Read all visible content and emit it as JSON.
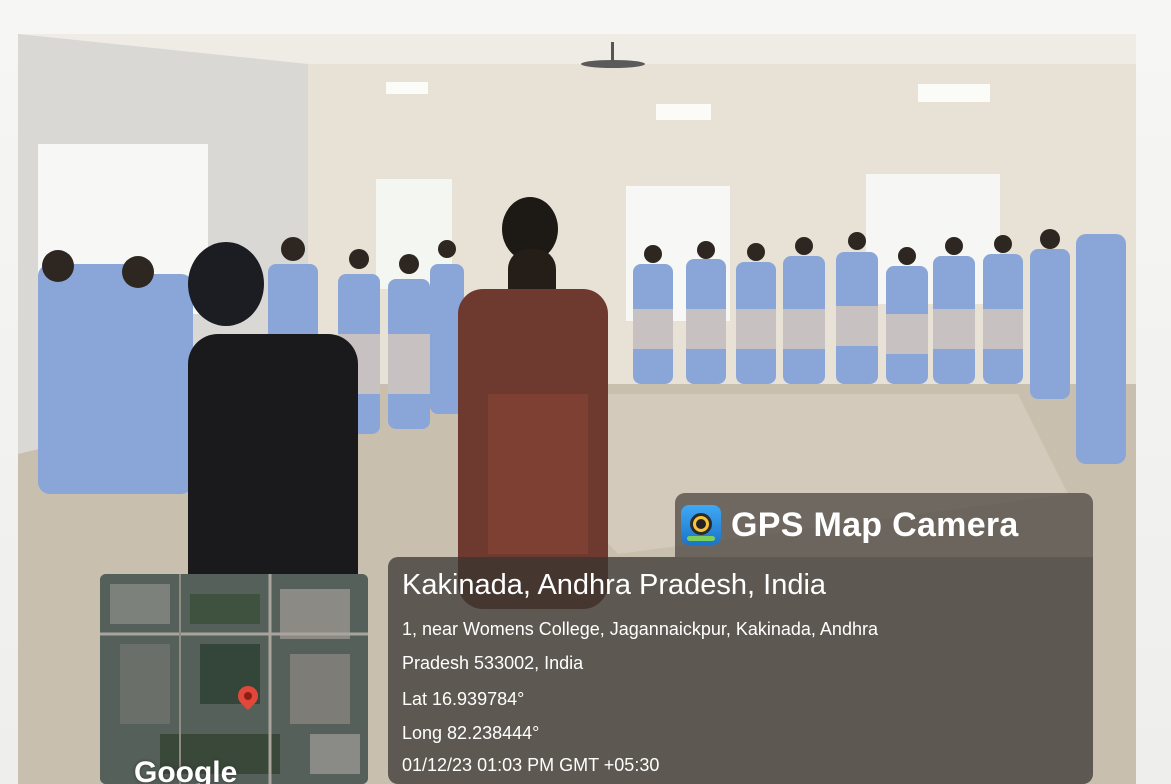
{
  "overlay": {
    "brand_label": "GPS Map Camera",
    "brand_icon": "gps-camera-app-icon",
    "place_title": "Kakinada, Andhra Pradesh, India",
    "address_line_1": "1, near Womens College, Jagannaickpur, Kakinada, Andhra",
    "address_line_2": "Pradesh 533002, India",
    "latitude": "Lat 16.939784°",
    "longitude": "Long 82.238444°",
    "timestamp": "01/12/23 01:03 PM GMT +05:30"
  },
  "map_thumbnail": {
    "watermark": "Google",
    "pin_icon": "location-pin-icon"
  },
  "colors": {
    "overlay_bg": "#37342f",
    "pin": "#e2483a",
    "uniform_blue": "#8aa6d8"
  }
}
